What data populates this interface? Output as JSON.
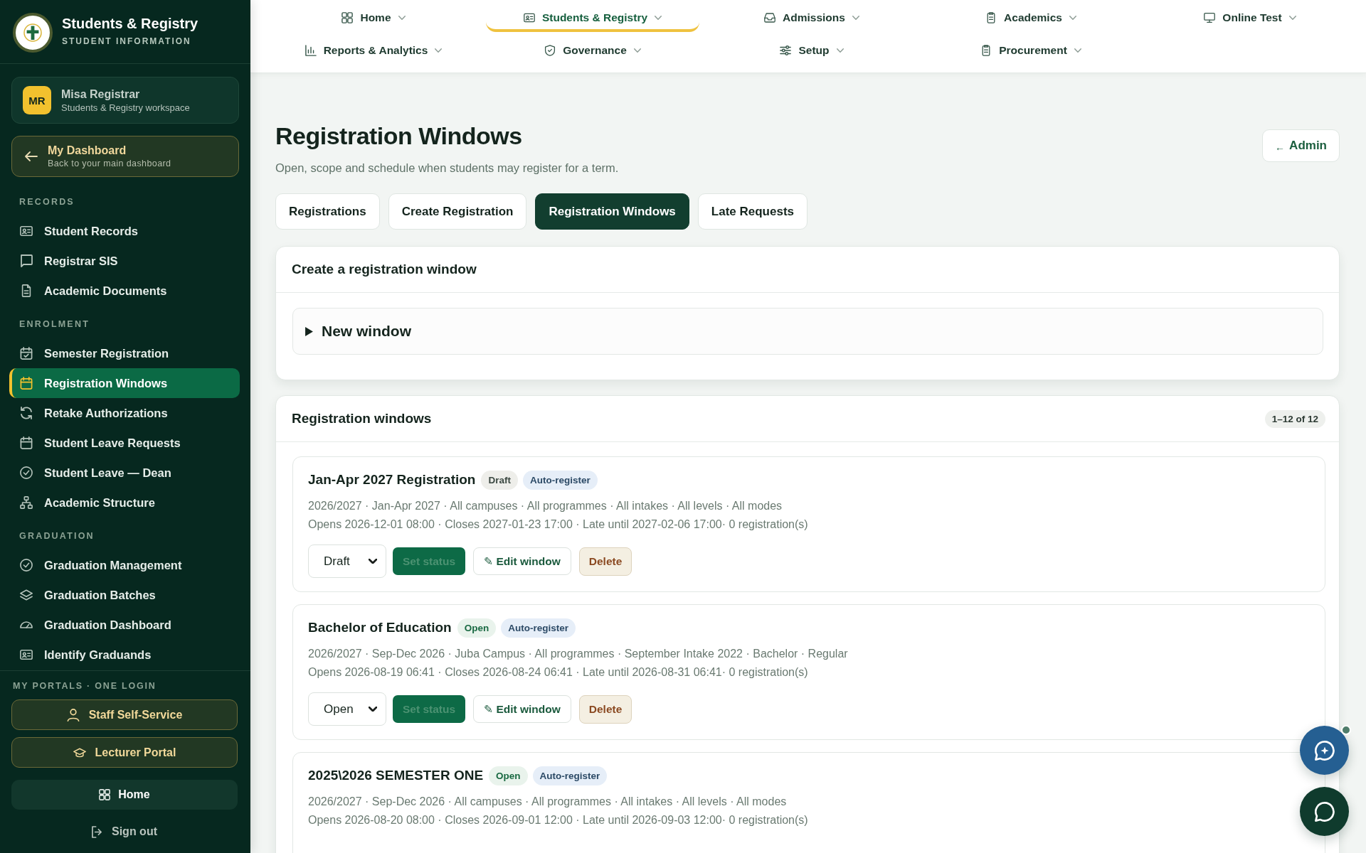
{
  "sidebar": {
    "brand": {
      "title": "Students & Registry",
      "subtitle": "STUDENT INFORMATION"
    },
    "user": {
      "initials": "MR",
      "name": "Misa Registrar",
      "workspace": "Students & Registry workspace"
    },
    "back_link": {
      "title": "My Dashboard",
      "subtitle": "Back to your main dashboard"
    },
    "sections": [
      {
        "label": "RECORDS",
        "items": [
          {
            "label": "Student Records",
            "selected": false
          },
          {
            "label": "Registrar SIS",
            "selected": false
          },
          {
            "label": "Academic Documents",
            "selected": false
          }
        ]
      },
      {
        "label": "ENROLMENT",
        "items": [
          {
            "label": "Semester Registration",
            "selected": false
          },
          {
            "label": "Registration Windows",
            "selected": true
          },
          {
            "label": "Retake Authorizations",
            "selected": false
          },
          {
            "label": "Student Leave Requests",
            "selected": false
          },
          {
            "label": "Student Leave — Dean",
            "selected": false
          },
          {
            "label": "Academic Structure",
            "selected": false
          }
        ]
      },
      {
        "label": "GRADUATION",
        "items": [
          {
            "label": "Graduation Management",
            "selected": false
          },
          {
            "label": "Graduation Batches",
            "selected": false
          },
          {
            "label": "Graduation Dashboard",
            "selected": false
          },
          {
            "label": "Identify Graduands",
            "selected": false
          }
        ]
      }
    ],
    "portals": {
      "label": "MY PORTALS · ONE LOGIN",
      "links": [
        "Staff Self-Service",
        "Lecturer Portal"
      ]
    },
    "home_button": "Home",
    "sign_out": "Sign out"
  },
  "top_nav": {
    "rows": [
      [
        {
          "label": "Home",
          "selected": false
        },
        {
          "label": "Students & Registry",
          "selected": true
        },
        {
          "label": "Admissions",
          "selected": false
        },
        {
          "label": "Academics",
          "selected": false
        },
        {
          "label": "Online Test",
          "selected": false
        }
      ],
      [
        {
          "label": "Reports & Analytics",
          "selected": false
        },
        {
          "label": "Governance",
          "selected": false
        },
        {
          "label": "Setup",
          "selected": false
        },
        {
          "label": "Procurement",
          "selected": false
        }
      ]
    ]
  },
  "page": {
    "title": "Registration Windows",
    "subtitle": "Open, scope and schedule when students may register for a term.",
    "back_button": {
      "arrow": "←",
      "label": "Admin"
    }
  },
  "tabs": [
    {
      "label": "Registrations",
      "selected": false
    },
    {
      "label": "Create Registration",
      "selected": false
    },
    {
      "label": "Registration Windows",
      "selected": true
    },
    {
      "label": "Late Requests",
      "selected": false
    }
  ],
  "create_panel": {
    "title": "Create a registration window",
    "toggle": {
      "label": "New window",
      "expanded": false
    }
  },
  "windows_panel": {
    "title": "Registration windows",
    "count": "1–12 of 12",
    "windows": [
      {
        "title": "Jan-Apr 2027 Registration",
        "badges": [
          {
            "label": "Draft",
            "kind": "draft"
          },
          {
            "label": "Auto-register",
            "kind": "mode"
          }
        ],
        "scope": "2026/2027 · Jan-Apr 2027 · All campuses · All programmes · All intakes · All levels · All modes",
        "schedule": "Opens 2026-12-01 08:00 · Closes 2027-01-23 17:00 · Late until 2027-02-06 17:00· 0 registration(s)",
        "actions": {
          "status_select": "Draft",
          "set_status": {
            "label": "Set status",
            "disabled": true
          },
          "edit": "✎ Edit window",
          "delete": "Delete"
        }
      },
      {
        "title": "Bachelor of Education",
        "badges": [
          {
            "label": "Open",
            "kind": "open"
          },
          {
            "label": "Auto-register",
            "kind": "mode"
          }
        ],
        "scope": "2026/2027 · Sep-Dec 2026 · Juba Campus · All programmes · September Intake 2022 · Bachelor · Regular",
        "schedule": "Opens 2026-08-19 06:41 · Closes 2026-08-24 06:41 · Late until 2026-08-31 06:41· 0 registration(s)",
        "actions": {
          "status_select": "Open",
          "set_status": {
            "label": "Set status",
            "disabled": true
          },
          "edit": "✎ Edit window",
          "delete": "Delete"
        }
      },
      {
        "title": "2025\\2026 SEMESTER ONE",
        "badges": [
          {
            "label": "Open",
            "kind": "open"
          },
          {
            "label": "Auto-register",
            "kind": "mode"
          }
        ],
        "scope": "2026/2027 · Sep-Dec 2026 · All campuses · All programmes · All intakes · All levels · All modes",
        "schedule": "Opens 2026-08-20 08:00 · Closes 2026-09-01 12:00 · Late until 2026-09-03 12:00· 0 registration(s)"
      }
    ]
  },
  "chat_buttons": [
    {
      "kind": "assistant",
      "notification": true
    },
    {
      "kind": "chat",
      "notification": false
    }
  ]
}
